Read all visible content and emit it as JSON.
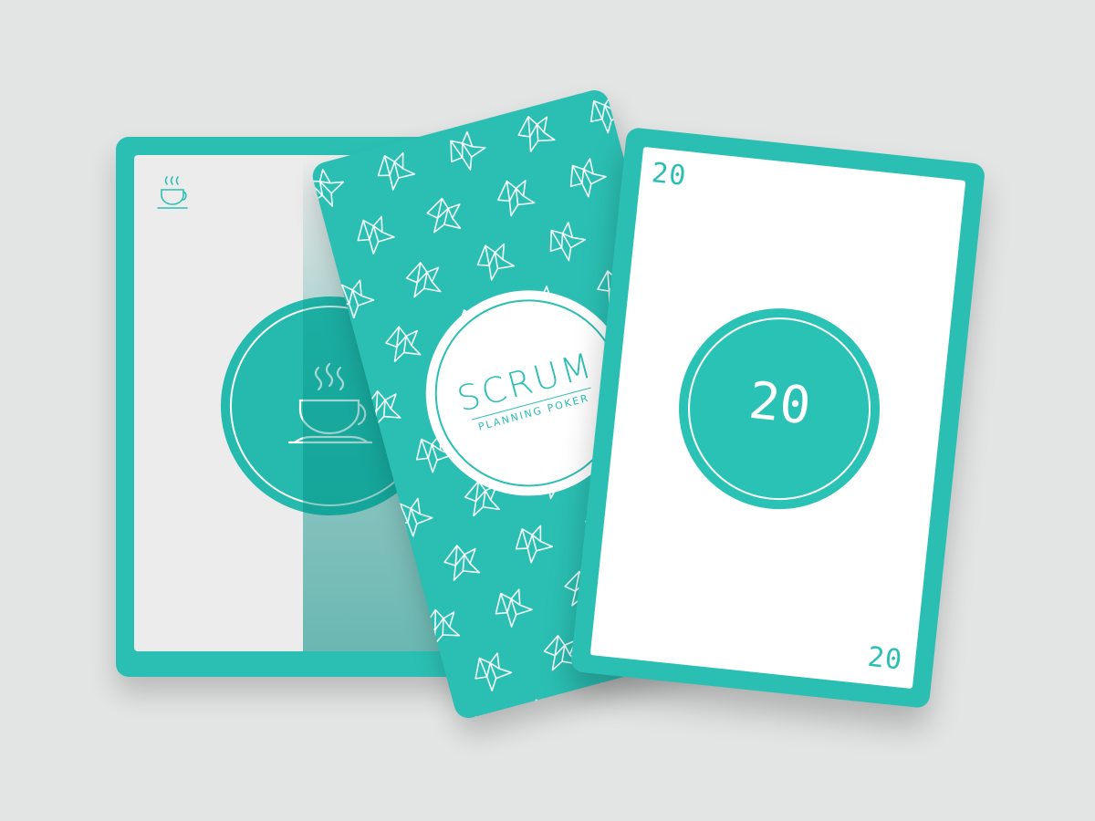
{
  "colors": {
    "background": "#e3e4e4",
    "teal": "#2bbfb3",
    "card_face": "#ffffff"
  },
  "cards": {
    "coffee": {
      "icon": "coffee-cup-icon"
    },
    "back": {
      "title": "SCRUM",
      "subtitle": "PLANNING POKER",
      "pattern_icon": "origami-crane-icon"
    },
    "number": {
      "value": "20",
      "corner_top": "20",
      "corner_bottom": "20"
    }
  }
}
